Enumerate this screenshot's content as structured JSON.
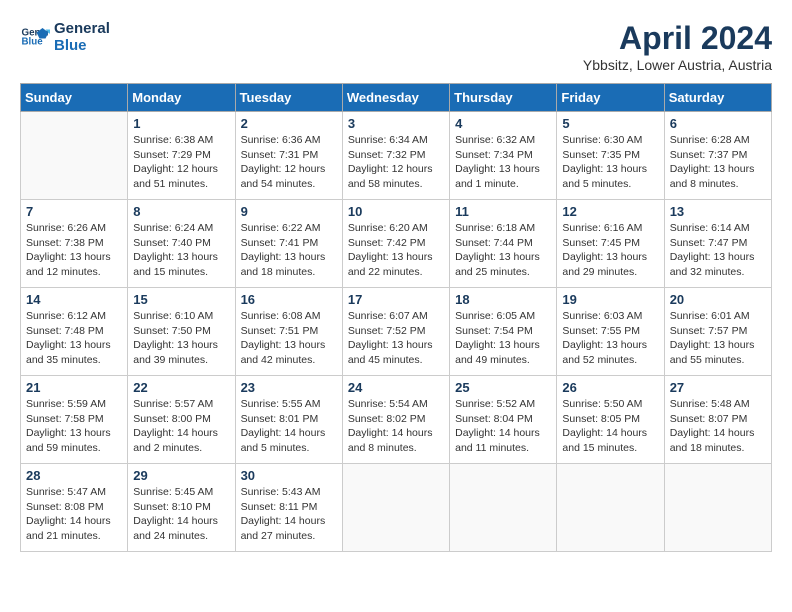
{
  "header": {
    "logo_text_general": "General",
    "logo_text_blue": "Blue",
    "month_year": "April 2024",
    "location": "Ybbsitz, Lower Austria, Austria"
  },
  "weekdays": [
    "Sunday",
    "Monday",
    "Tuesday",
    "Wednesday",
    "Thursday",
    "Friday",
    "Saturday"
  ],
  "weeks": [
    [
      {
        "day": "",
        "info": ""
      },
      {
        "day": "1",
        "info": "Sunrise: 6:38 AM\nSunset: 7:29 PM\nDaylight: 12 hours\nand 51 minutes."
      },
      {
        "day": "2",
        "info": "Sunrise: 6:36 AM\nSunset: 7:31 PM\nDaylight: 12 hours\nand 54 minutes."
      },
      {
        "day": "3",
        "info": "Sunrise: 6:34 AM\nSunset: 7:32 PM\nDaylight: 12 hours\nand 58 minutes."
      },
      {
        "day": "4",
        "info": "Sunrise: 6:32 AM\nSunset: 7:34 PM\nDaylight: 13 hours\nand 1 minute."
      },
      {
        "day": "5",
        "info": "Sunrise: 6:30 AM\nSunset: 7:35 PM\nDaylight: 13 hours\nand 5 minutes."
      },
      {
        "day": "6",
        "info": "Sunrise: 6:28 AM\nSunset: 7:37 PM\nDaylight: 13 hours\nand 8 minutes."
      }
    ],
    [
      {
        "day": "7",
        "info": "Sunrise: 6:26 AM\nSunset: 7:38 PM\nDaylight: 13 hours\nand 12 minutes."
      },
      {
        "day": "8",
        "info": "Sunrise: 6:24 AM\nSunset: 7:40 PM\nDaylight: 13 hours\nand 15 minutes."
      },
      {
        "day": "9",
        "info": "Sunrise: 6:22 AM\nSunset: 7:41 PM\nDaylight: 13 hours\nand 18 minutes."
      },
      {
        "day": "10",
        "info": "Sunrise: 6:20 AM\nSunset: 7:42 PM\nDaylight: 13 hours\nand 22 minutes."
      },
      {
        "day": "11",
        "info": "Sunrise: 6:18 AM\nSunset: 7:44 PM\nDaylight: 13 hours\nand 25 minutes."
      },
      {
        "day": "12",
        "info": "Sunrise: 6:16 AM\nSunset: 7:45 PM\nDaylight: 13 hours\nand 29 minutes."
      },
      {
        "day": "13",
        "info": "Sunrise: 6:14 AM\nSunset: 7:47 PM\nDaylight: 13 hours\nand 32 minutes."
      }
    ],
    [
      {
        "day": "14",
        "info": "Sunrise: 6:12 AM\nSunset: 7:48 PM\nDaylight: 13 hours\nand 35 minutes."
      },
      {
        "day": "15",
        "info": "Sunrise: 6:10 AM\nSunset: 7:50 PM\nDaylight: 13 hours\nand 39 minutes."
      },
      {
        "day": "16",
        "info": "Sunrise: 6:08 AM\nSunset: 7:51 PM\nDaylight: 13 hours\nand 42 minutes."
      },
      {
        "day": "17",
        "info": "Sunrise: 6:07 AM\nSunset: 7:52 PM\nDaylight: 13 hours\nand 45 minutes."
      },
      {
        "day": "18",
        "info": "Sunrise: 6:05 AM\nSunset: 7:54 PM\nDaylight: 13 hours\nand 49 minutes."
      },
      {
        "day": "19",
        "info": "Sunrise: 6:03 AM\nSunset: 7:55 PM\nDaylight: 13 hours\nand 52 minutes."
      },
      {
        "day": "20",
        "info": "Sunrise: 6:01 AM\nSunset: 7:57 PM\nDaylight: 13 hours\nand 55 minutes."
      }
    ],
    [
      {
        "day": "21",
        "info": "Sunrise: 5:59 AM\nSunset: 7:58 PM\nDaylight: 13 hours\nand 59 minutes."
      },
      {
        "day": "22",
        "info": "Sunrise: 5:57 AM\nSunset: 8:00 PM\nDaylight: 14 hours\nand 2 minutes."
      },
      {
        "day": "23",
        "info": "Sunrise: 5:55 AM\nSunset: 8:01 PM\nDaylight: 14 hours\nand 5 minutes."
      },
      {
        "day": "24",
        "info": "Sunrise: 5:54 AM\nSunset: 8:02 PM\nDaylight: 14 hours\nand 8 minutes."
      },
      {
        "day": "25",
        "info": "Sunrise: 5:52 AM\nSunset: 8:04 PM\nDaylight: 14 hours\nand 11 minutes."
      },
      {
        "day": "26",
        "info": "Sunrise: 5:50 AM\nSunset: 8:05 PM\nDaylight: 14 hours\nand 15 minutes."
      },
      {
        "day": "27",
        "info": "Sunrise: 5:48 AM\nSunset: 8:07 PM\nDaylight: 14 hours\nand 18 minutes."
      }
    ],
    [
      {
        "day": "28",
        "info": "Sunrise: 5:47 AM\nSunset: 8:08 PM\nDaylight: 14 hours\nand 21 minutes."
      },
      {
        "day": "29",
        "info": "Sunrise: 5:45 AM\nSunset: 8:10 PM\nDaylight: 14 hours\nand 24 minutes."
      },
      {
        "day": "30",
        "info": "Sunrise: 5:43 AM\nSunset: 8:11 PM\nDaylight: 14 hours\nand 27 minutes."
      },
      {
        "day": "",
        "info": ""
      },
      {
        "day": "",
        "info": ""
      },
      {
        "day": "",
        "info": ""
      },
      {
        "day": "",
        "info": ""
      }
    ]
  ]
}
